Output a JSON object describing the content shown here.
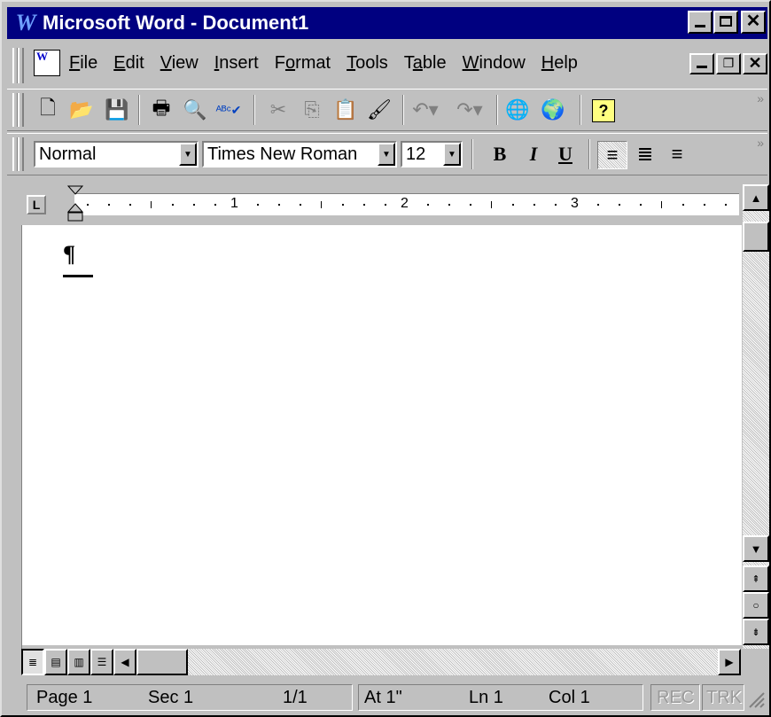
{
  "window": {
    "title": "Microsoft Word - Document1",
    "logo": "W",
    "controls": [
      "minimize-icon",
      "maximize-icon",
      "close-icon"
    ]
  },
  "menubar": {
    "items": [
      {
        "label": "File",
        "hotkey": "F"
      },
      {
        "label": "Edit",
        "hotkey": "E"
      },
      {
        "label": "View",
        "hotkey": "V"
      },
      {
        "label": "Insert",
        "hotkey": "I"
      },
      {
        "label": "Format",
        "hotkey": "o"
      },
      {
        "label": "Tools",
        "hotkey": "T"
      },
      {
        "label": "Table",
        "hotkey": "a"
      },
      {
        "label": "Window",
        "hotkey": "W"
      },
      {
        "label": "Help",
        "hotkey": "H"
      }
    ],
    "doc_icon_label": "W"
  },
  "standard_toolbar": {
    "tools": [
      "new-icon",
      "open-icon",
      "save-icon",
      "print-icon",
      "print-preview-icon",
      "spelling-icon",
      "cut-icon",
      "copy-icon",
      "paste-icon",
      "format-painter-icon",
      "undo-icon",
      "redo-icon",
      "web-icon",
      "web-toolbar-icon",
      "help-icon"
    ]
  },
  "formatting_toolbar": {
    "style": "Normal",
    "font": "Times New Roman",
    "size": "12",
    "bold": "B",
    "italic": "I",
    "underline": "U",
    "align_left_active": true
  },
  "ruler": {
    "tab_selector": "L",
    "numbers": [
      "1",
      "2",
      "3"
    ]
  },
  "document": {
    "pilcrow": "¶"
  },
  "statusbar": {
    "page": "Page 1",
    "sec": "Sec 1",
    "pages": "1/1",
    "at": "At 1\"",
    "ln": "Ln 1",
    "col": "Col 1",
    "rec": "REC",
    "trk": "TRK"
  },
  "colors": {
    "titlebar": "#000080",
    "face": "#c0c0c0"
  }
}
